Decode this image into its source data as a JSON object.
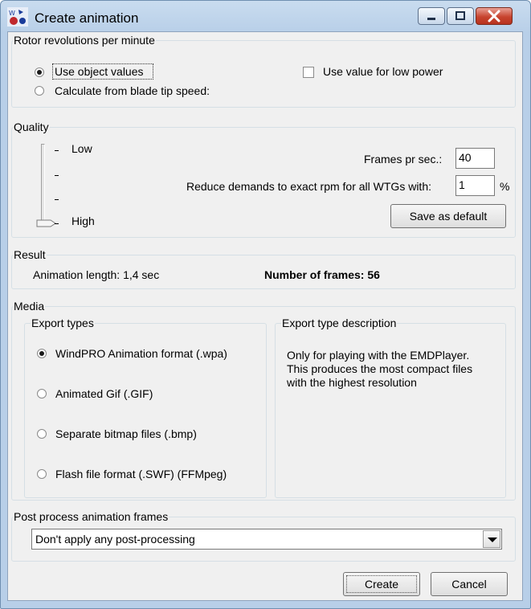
{
  "window": {
    "title": "Create animation",
    "app_icon": "windpro-app-icon",
    "controls": [
      "minimize-icon",
      "maximize-icon",
      "close-icon"
    ]
  },
  "rotor": {
    "legend": "Rotor revolutions per minute",
    "options": [
      {
        "label": "Use object values",
        "checked": true
      },
      {
        "label": "Calculate from blade tip speed:",
        "checked": false
      }
    ],
    "low_power_label": "Use value for low power",
    "low_power_checked": false
  },
  "quality": {
    "legend": "Quality",
    "slider_low_label": "Low",
    "slider_high_label": "High",
    "slider_level": "High",
    "frames_label": "Frames pr sec.:",
    "frames_value": "40",
    "reduce_label": "Reduce demands to exact rpm for all WTGs with:",
    "reduce_value": "1",
    "reduce_unit": "%",
    "save_default_label": "Save as default"
  },
  "result": {
    "legend": "Result",
    "animation_length": "Animation length: 1,4 sec",
    "number_of_frames": "Number of frames: 56"
  },
  "media": {
    "legend": "Media",
    "export_types_legend": "Export types",
    "export_types": [
      {
        "label": "WindPRO Animation format (.wpa)",
        "checked": true
      },
      {
        "label": "Animated Gif (.GIF)",
        "checked": false
      },
      {
        "label": "Separate bitmap files (.bmp)",
        "checked": false
      },
      {
        "label": "Flash file format (.SWF) (FFMpeg)",
        "checked": false
      }
    ],
    "description_legend": "Export type description",
    "description_lines": [
      "Only for playing with the EMDPlayer.",
      "This produces the most compact files",
      "with the highest resolution"
    ]
  },
  "post_process": {
    "legend": "Post process animation frames",
    "selected": "Don't apply any post-processing"
  },
  "buttons": {
    "create": "Create",
    "cancel": "Cancel"
  },
  "colors": {
    "titlebar": "#b8cfe8",
    "client": "#f0f0f0",
    "close_button": "#c7442f"
  }
}
